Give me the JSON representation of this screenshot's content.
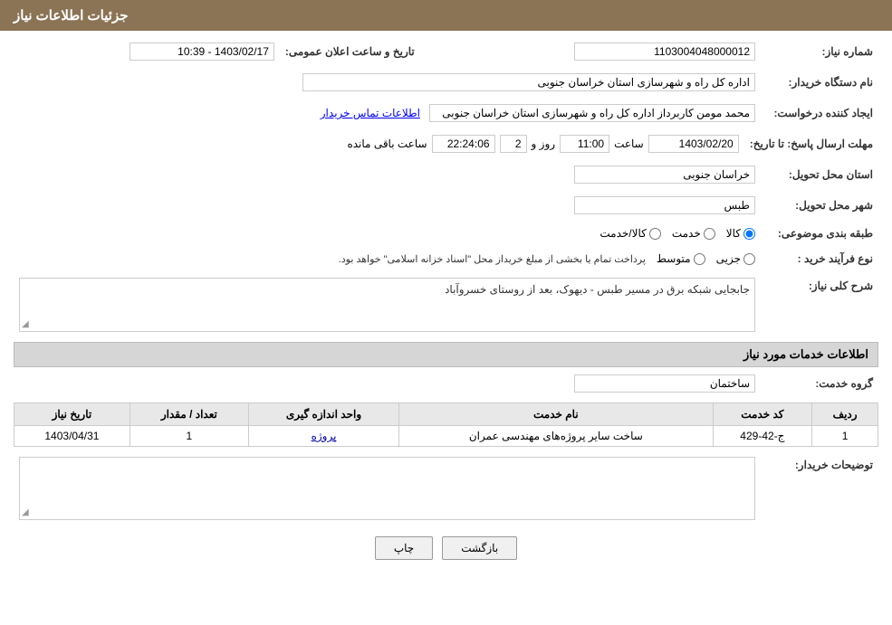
{
  "header": {
    "title": "جزئیات اطلاعات نیاز"
  },
  "fields": {
    "need_number_label": "شماره نیاز:",
    "need_number_value": "1103004048000012",
    "announce_date_label": "تاریخ و ساعت اعلان عمومی:",
    "announce_date_value": "1403/02/17 - 10:39",
    "buyer_org_label": "نام دستگاه خریدار:",
    "buyer_org_value": "اداره کل راه و شهرسازی استان خراسان جنوبی",
    "creator_label": "ایجاد کننده درخواست:",
    "creator_value": "محمد مومن کاربرداز اداره کل راه و شهرسازی استان خراسان جنوبی",
    "contact_link": "اطلاعات تماس خریدار",
    "deadline_label": "مهلت ارسال پاسخ: تا تاریخ:",
    "deadline_date": "1403/02/20",
    "deadline_time_label": "ساعت",
    "deadline_time": "11:00",
    "deadline_day_label": "روز و",
    "deadline_days": "2",
    "deadline_remaining_label": "ساعت باقی مانده",
    "deadline_remaining": "22:24:06",
    "province_label": "استان محل تحویل:",
    "province_value": "خراسان جنوبی",
    "city_label": "شهر محل تحویل:",
    "city_value": "طبس",
    "category_label": "طبقه بندی موضوعی:",
    "category_options": [
      "کالا",
      "خدمت",
      "کالا/خدمت"
    ],
    "category_selected": "کالا",
    "purchase_type_label": "نوع فرآیند خرید :",
    "purchase_options": [
      "جزیی",
      "متوسط"
    ],
    "purchase_note": "پرداخت تمام یا بخشی از مبلغ خریداز محل \"اسناد خزانه اسلامی\" خواهد بود.",
    "description_label": "شرح کلی نیاز:",
    "description_value": "جابجایی شبکه برق در مسیر طبس - دیهوک، بعد از روستای خسروآباد",
    "services_section_label": "اطلاعات خدمات مورد نیاز",
    "service_group_label": "گروه خدمت:",
    "service_group_value": "ساختمان",
    "table_headers": [
      "ردیف",
      "کد خدمت",
      "نام خدمت",
      "واحد اندازه گیری",
      "تعداد / مقدار",
      "تاریخ نیاز"
    ],
    "table_rows": [
      {
        "row": "1",
        "code": "ج-42-429",
        "name": "ساخت سایر پروژه‌های مهندسی عمران",
        "unit": "پروژه",
        "quantity": "1",
        "date": "1403/04/31"
      }
    ],
    "buyer_notes_label": "توضیحات خریدار:",
    "buyer_notes_value": "",
    "btn_print": "چاپ",
    "btn_back": "بازگشت"
  }
}
